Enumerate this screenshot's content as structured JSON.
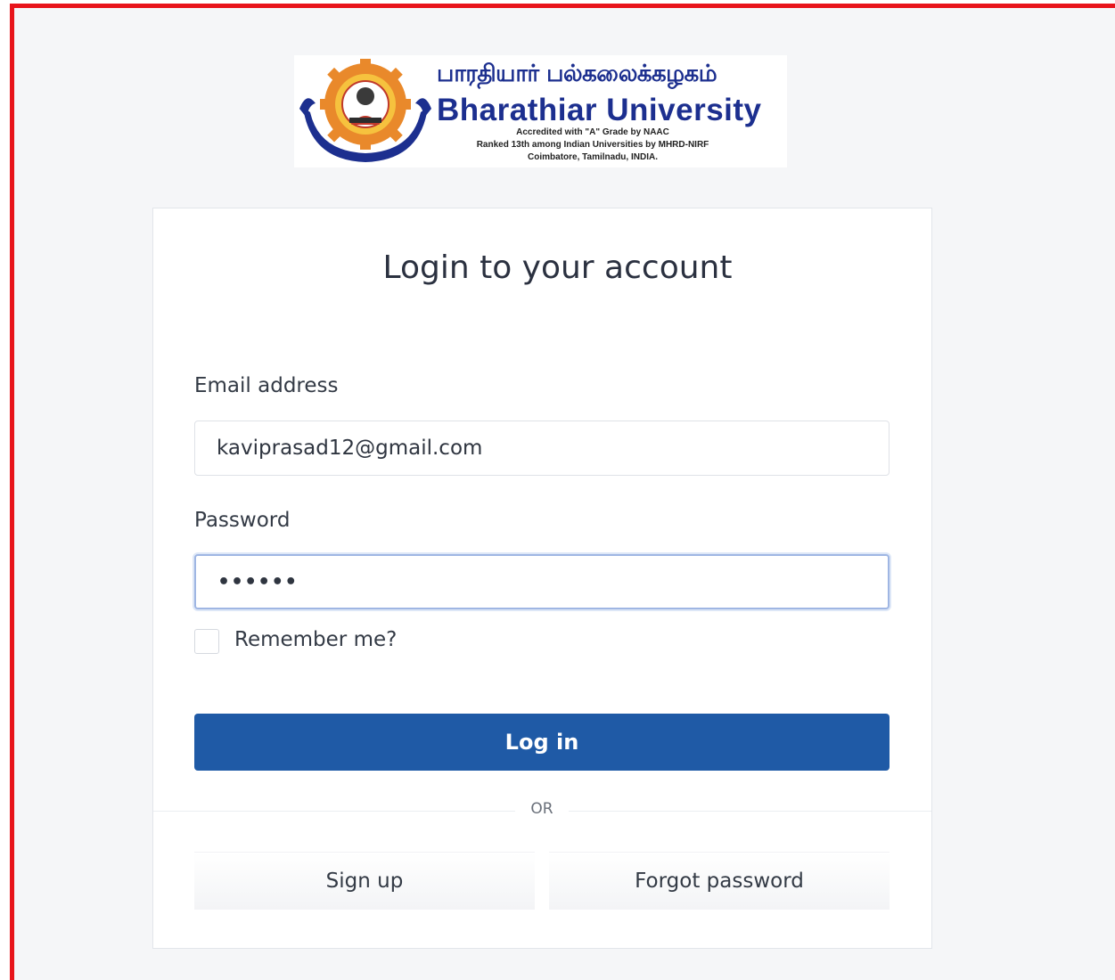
{
  "logo": {
    "tamil_name": "பாரதியார் பல்கலைக்கழகம்",
    "english_name": "Bharathiar University",
    "line1": "Accredited with \"A\" Grade by NAAC",
    "line2": "Ranked 13th among Indian Universities by MHRD-NIRF",
    "line3": "Coimbatore, Tamilnadu, INDIA."
  },
  "form": {
    "title": "Login to your account",
    "email_label": "Email address",
    "email_value": "kaviprasad12@gmail.com",
    "password_label": "Password",
    "password_value": "••••••",
    "remember_label": "Remember me?",
    "login_button": "Log in",
    "or_text": "OR",
    "signup_button": "Sign up",
    "forgot_button": "Forgot password"
  },
  "colors": {
    "frame_border": "#e8141b",
    "primary": "#1f5aa6",
    "logo_text": "#1c2f8f"
  }
}
